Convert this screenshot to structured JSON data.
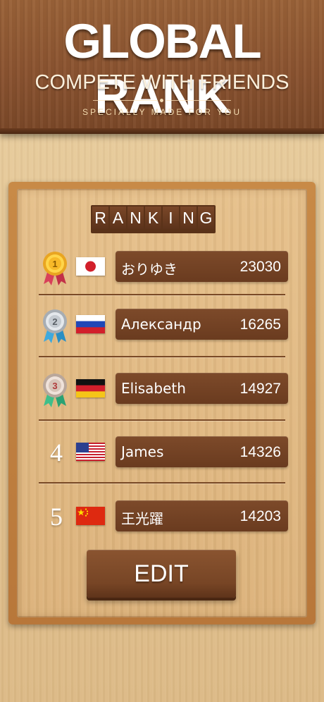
{
  "banner": {
    "title": "GLOBAL RANK",
    "subtitle": "COMPETE WITH FRIENDS",
    "tagline": "SPECIALLY MADE FOR YOU"
  },
  "board": {
    "heading_letters": [
      "R",
      "A",
      "N",
      "K",
      "I",
      "N",
      "G"
    ],
    "rows": [
      {
        "rank": "1",
        "flag_icon": "japan-flag-icon",
        "medal_icon": "gold-medal-icon",
        "name": "おりゆき",
        "score": "23030"
      },
      {
        "rank": "2",
        "flag_icon": "russia-flag-icon",
        "medal_icon": "silver-medal-icon",
        "name": "Александр",
        "score": "16265"
      },
      {
        "rank": "3",
        "flag_icon": "germany-flag-icon",
        "medal_icon": "bronze-medal-icon",
        "name": "Elisabeth",
        "score": "14927"
      },
      {
        "rank": "4",
        "flag_icon": "usa-flag-icon",
        "name": "James",
        "score": "14326"
      },
      {
        "rank": "5",
        "flag_icon": "china-flag-icon",
        "name": "王光躍",
        "score": "14203"
      }
    ],
    "edit_label": "EDIT"
  },
  "colors": {
    "banner_wood": "#8a5330",
    "board_wood": "#dcb27a",
    "pill": "#6a3b1f"
  }
}
